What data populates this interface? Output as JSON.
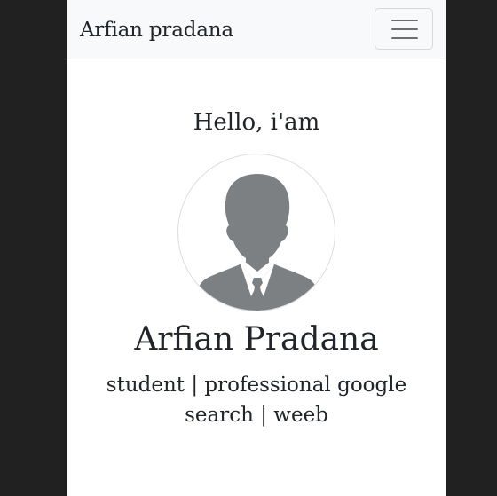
{
  "navbar": {
    "brand": "Arfian pradana",
    "toggler_icon": "hamburger-menu-icon"
  },
  "hero": {
    "greeting": "Hello, i'am",
    "avatar_icon": "default-user-avatar-icon",
    "name": "Arfian Pradana",
    "tagline": "student | professional google search | weeb"
  },
  "colors": {
    "page_background": "#212121",
    "navbar_background": "#f8f9fa",
    "content_background": "#ffffff",
    "text": "#212529",
    "avatar_silhouette": "#7d8083"
  }
}
